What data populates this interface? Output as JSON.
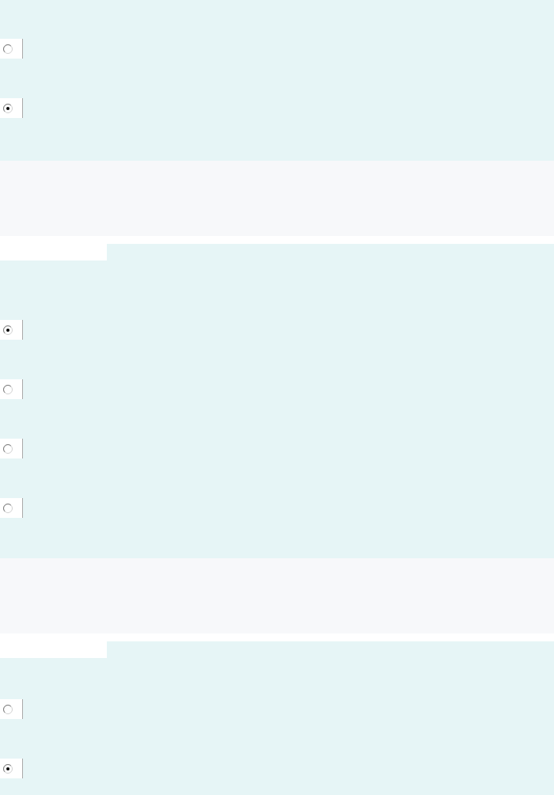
{
  "questions": [
    {
      "options": [
        {
          "selected": false
        },
        {
          "selected": true
        }
      ]
    },
    {
      "options": [
        {
          "selected": true
        },
        {
          "selected": false
        },
        {
          "selected": false
        },
        {
          "selected": false
        }
      ]
    },
    {
      "options": [
        {
          "selected": false
        },
        {
          "selected": true
        }
      ]
    }
  ]
}
